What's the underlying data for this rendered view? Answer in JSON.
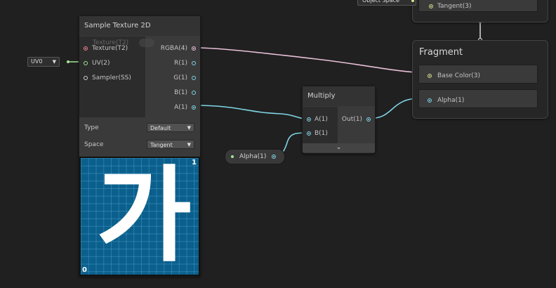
{
  "colors": {
    "background": "#202020",
    "node": "#393939",
    "wire_rgba": "#e9c0d8",
    "wire_vector3": "#d8dd8a",
    "wire_vector1": "#7fd5e6",
    "wire_uv": "#a3e596",
    "texture_port": "#f08090",
    "preview_bg": "#0b5f8c"
  },
  "sample_texture_node": {
    "title": "Sample Texture 2D",
    "inputs": [
      {
        "label": "Texture(T2)",
        "icon": "texture-port-icon"
      },
      {
        "label": "UV(2)",
        "icon": "uv-port-icon"
      },
      {
        "label": "Sampler(SS)",
        "icon": "sampler-port-icon"
      }
    ],
    "outputs": [
      {
        "label": "RGBA(4)"
      },
      {
        "label": "R(1)"
      },
      {
        "label": "G(1)"
      },
      {
        "label": "B(1)"
      },
      {
        "label": "A(1)"
      }
    ],
    "type_label": "Type",
    "type_value": "Default",
    "space_label": "Space",
    "space_value": "Tangent",
    "preview_glyph": "가",
    "preview_corner_top": "1",
    "preview_corner_bottom": "0",
    "ghost_text": "Texture(T2)"
  },
  "uv_input": {
    "value": "UV0"
  },
  "multiply_node": {
    "title": "Multiply",
    "inputs": [
      {
        "label": "A(1)"
      },
      {
        "label": "B(1)"
      }
    ],
    "outputs": [
      {
        "label": "Out(1)"
      }
    ],
    "expand_icon": "chevron-down-icon"
  },
  "alpha_property": {
    "label": "Alpha(1)"
  },
  "fragment_node": {
    "title": "Fragment",
    "slots": [
      {
        "label": "Base Color(3)"
      },
      {
        "label": "Alpha(1)"
      }
    ]
  },
  "vertex_node": {
    "slots": [
      {
        "label": "Tangent(3)"
      }
    ],
    "space_input": "Object Space"
  }
}
